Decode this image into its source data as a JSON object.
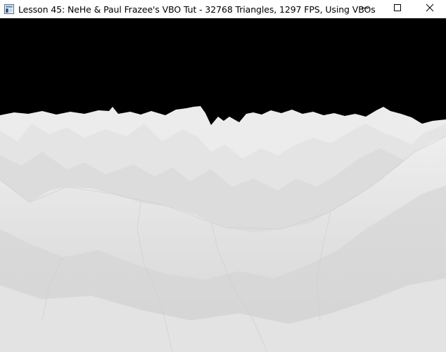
{
  "window": {
    "title": "Lesson 45: NeHe & Paul Frazee's VBO Tut - 32768 Triangles, 1297 FPS, Using VBOs",
    "icon": "opengl-app-icon",
    "controls": {
      "minimize_icon": "minimize-icon",
      "maximize_icon": "maximize-icon",
      "close_icon": "close-icon"
    }
  },
  "scene": {
    "description_icon": "terrain-heightmap",
    "sky_color": "#000000",
    "terrain_color": "#e2e2e2"
  }
}
